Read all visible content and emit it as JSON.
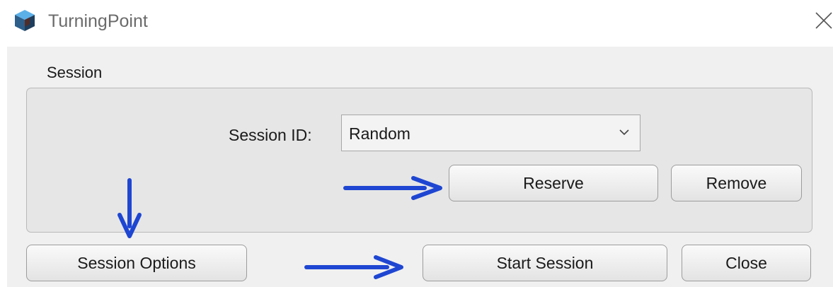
{
  "window": {
    "title": "TurningPoint",
    "app_icon": "turningpoint-cube-icon",
    "close_icon": "close-icon"
  },
  "session_group": {
    "label": "Session",
    "session_id_label": "Session ID:",
    "session_id_value": "Random",
    "reserve_label": "Reserve",
    "remove_label": "Remove"
  },
  "footer": {
    "session_options_label": "Session Options",
    "start_session_label": "Start Session",
    "close_label": "Close"
  },
  "annotations": {
    "arrow_color": "#1e46d2"
  }
}
